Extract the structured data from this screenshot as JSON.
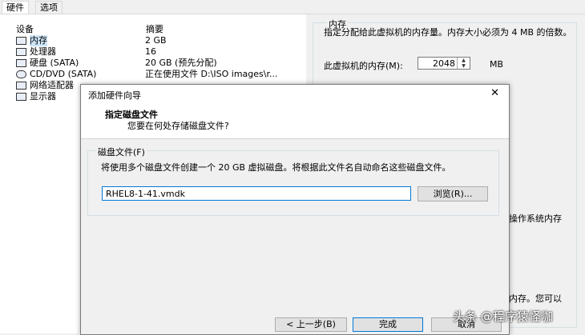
{
  "tabs": [
    {
      "label": "硬件"
    },
    {
      "label": "选项"
    }
  ],
  "device_list": {
    "col_device": "设备",
    "col_summary": "摘要",
    "rows": [
      {
        "name": "内存",
        "summary": "2 GB",
        "icon": "memory-icon"
      },
      {
        "name": "处理器",
        "summary": "16",
        "icon": "cpu-icon"
      },
      {
        "name": "硬盘 (SATA)",
        "summary": "20 GB (预先分配)",
        "icon": "disk-icon"
      },
      {
        "name": "CD/DVD (SATA)",
        "summary": "正在使用文件 D:\\ISO images\\r...",
        "icon": "cdrom-icon"
      },
      {
        "name": "网络适配器",
        "summary": "",
        "icon": "network-icon"
      },
      {
        "name": "显示器",
        "summary": "",
        "icon": "display-icon"
      }
    ]
  },
  "memory": {
    "title": "内存",
    "desc": "指定分配给此虚拟机的内存量。内存大小必须为 4 MB 的倍数。",
    "label": "此虚拟机的内存(M):",
    "value": "2048",
    "unit": "MB",
    "text2": "操作系统内存",
    "text3": "内存。您可以"
  },
  "dialog": {
    "title": "添加硬件向导",
    "heading": "指定磁盘文件",
    "subheading": "您要在何处存储磁盘文件?",
    "group_title": "磁盘文件(F)",
    "group_desc": "将使用多个磁盘文件创建一个 20 GB 虚拟磁盘。将根据此文件名自动命名这些磁盘文件。",
    "file_value": "RHEL8-1-41.vmdk",
    "browse_label": "浏览(R)...",
    "back_label": "< 上一步(B)",
    "finish_label": "完成",
    "cancel_label": "取消"
  },
  "watermark": "头条 @程序猿怪咖"
}
